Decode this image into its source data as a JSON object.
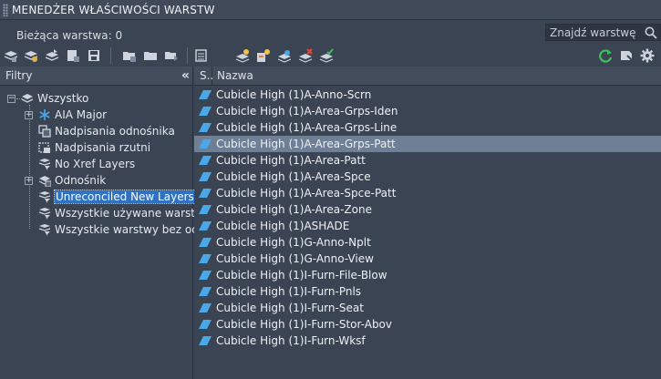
{
  "title": "MENEDŻER WŁAŚCIWOŚCI WARSTW",
  "current_layer": "Bieżąca warstwa: 0",
  "search": {
    "placeholder": "Znajdź warstwę"
  },
  "toolbar": {
    "left": [
      "new-property-filter-icon",
      "new-group-filter-icon",
      "layer-states-icon",
      "layer-states-manager-icon",
      "save-state-icon"
    ],
    "middle": [
      "new-layer-icon",
      "new-layer-vp-frozen-icon",
      "delete-layer-icon",
      "set-current-icon"
    ],
    "layer_ops": [
      "new-layer-icon",
      "new-layer-vp-icon",
      "layer-settings-icon",
      "delete-layer-icon",
      "set-current-icon"
    ],
    "right": [
      "refresh-icon",
      "settings-swatch-icon",
      "gear-icon"
    ]
  },
  "filters": {
    "header": "Filtry",
    "collapse_label": "«",
    "items": [
      {
        "label": "Wszystko",
        "icon": "layers-stack-icon"
      },
      {
        "label": "AIA Major",
        "icon": "snowflake-icon"
      },
      {
        "label": "Nadpisania odnośnika",
        "icon": "xref-override-icon"
      },
      {
        "label": "Nadpisania rzutni",
        "icon": "viewport-override-icon"
      },
      {
        "label": "No Xref Layers",
        "icon": "filter-icon"
      },
      {
        "label": "Odnośnik",
        "icon": "xref-icon"
      },
      {
        "label": "Unreconciled New Layers",
        "icon": "filter-icon"
      },
      {
        "label": "Wszystkie używane warstwy",
        "icon": "filter-icon"
      },
      {
        "label": "Wszystkie warstwy bez odnie",
        "icon": "filter-icon"
      }
    ]
  },
  "layers": {
    "col_s": "S..",
    "col_name": "Nazwa",
    "rows": [
      "Cubicle High (1)A-Anno-Scrn",
      "Cubicle High (1)A-Area-Grps-Iden",
      "Cubicle High (1)A-Area-Grps-Line",
      "Cubicle High (1)A-Area-Grps-Patt",
      "Cubicle High (1)A-Area-Patt",
      "Cubicle High (1)A-Area-Spce",
      "Cubicle High (1)A-Area-Spce-Patt",
      "Cubicle High (1)A-Area-Zone",
      "Cubicle High (1)ASHADE",
      "Cubicle High (1)G-Anno-Nplt",
      "Cubicle High (1)G-Anno-View",
      "Cubicle High (1)I-Furn-File-Blow",
      "Cubicle High (1)I-Furn-Pnls",
      "Cubicle High (1)I-Furn-Seat",
      "Cubicle High (1)I-Furn-Stor-Abov",
      "Cubicle High (1)I-Furn-Wksf"
    ],
    "selected": "Cubicle High (1)A-Area-Grps-Patt"
  },
  "colors": {
    "accent_blue": "#2f72c4",
    "selected_row": "#6e7f96",
    "layer_icon": "#4aa8e8",
    "refresh_green": "#3cc25a"
  }
}
